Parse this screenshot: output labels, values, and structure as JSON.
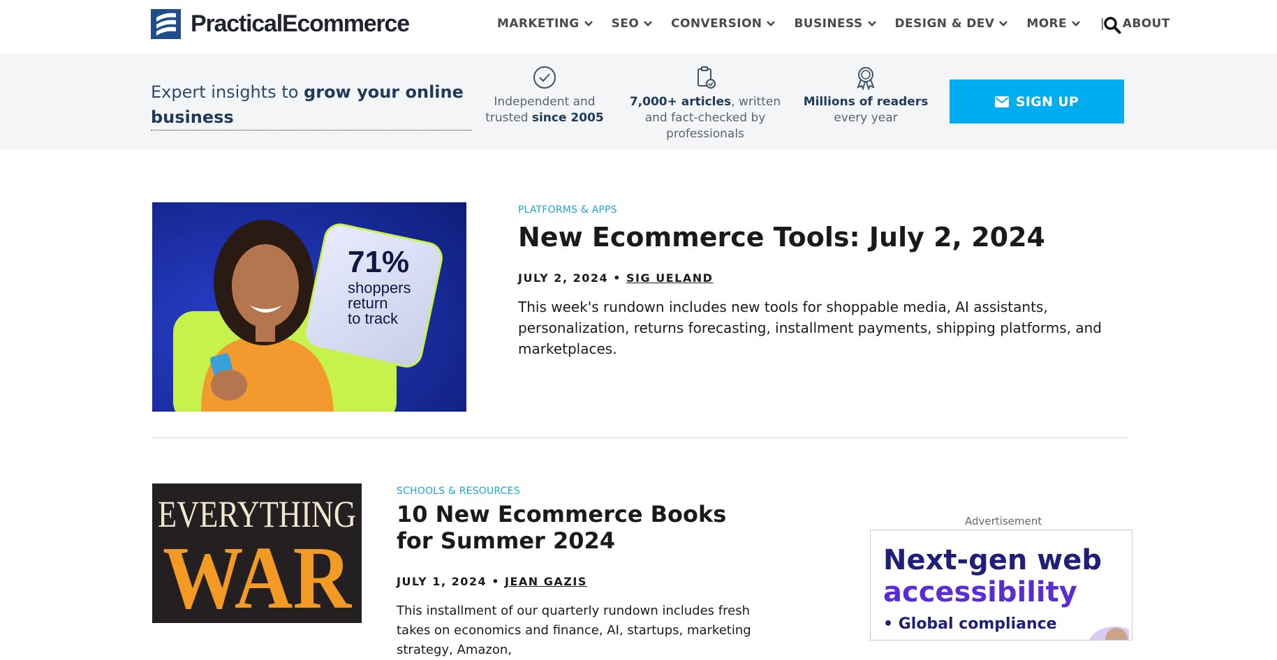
{
  "header": {
    "brand": "PracticalEcommerce",
    "nav": [
      {
        "label": "MARKETING",
        "dropdown": true
      },
      {
        "label": "SEO",
        "dropdown": true
      },
      {
        "label": "CONVERSION",
        "dropdown": true
      },
      {
        "label": "BUSINESS",
        "dropdown": true
      },
      {
        "label": "DESIGN & DEV",
        "dropdown": true
      },
      {
        "label": "MORE",
        "dropdown": true
      }
    ],
    "separator": "|",
    "about": "ABOUT",
    "search_icon": "search-icon"
  },
  "banner": {
    "tagline_prefix": "Expert insights to ",
    "tagline_bold": "grow your online business",
    "features": [
      {
        "icon": "check-circle-icon",
        "text_before": "Independent and trusted ",
        "bold": "since 2005",
        "text_after": ""
      },
      {
        "icon": "clipboard-check-icon",
        "text_before": "",
        "bold": "7,000+ articles",
        "text_after": ", written and fact-checked by professionals"
      },
      {
        "icon": "award-ribbon-icon",
        "text_before": "",
        "bold": "Millions of readers",
        "text_after": " every year"
      }
    ],
    "signup_label": "SIGN UP",
    "signup_icon": "envelope-icon",
    "accent": "#00adef"
  },
  "articles": [
    {
      "category": "PLATFORMS & APPS",
      "title": "New Ecommerce Tools: July 2, 2024",
      "date": "JULY 2, 2024",
      "bullet": "•",
      "author": "SIG UELAND",
      "excerpt": "This week's rundown includes new tools for shoppable media, AI assistants, personalization, returns forecasting, installment payments, shipping platforms, and marketplaces.",
      "image": {
        "big": "71%",
        "line1": "shoppers",
        "line2": "return",
        "line3": "to track"
      }
    },
    {
      "category": "SCHOOLS & RESOURCES",
      "title": "10 New Ecommerce Books for Summer 2024",
      "date": "JULY 1, 2024",
      "bullet": "•",
      "author": "JEAN GAZIS",
      "excerpt": "This installment of our quarterly rundown includes fresh takes on economics and finance, AI, startups, marketing strategy, Amazon,",
      "image": {
        "line1": "EVERYTHING",
        "line2": "WAR"
      }
    }
  ],
  "ad": {
    "label": "Advertisement",
    "line1": "Next-gen web",
    "line2": "accessibility",
    "line3": "• Global compliance"
  }
}
